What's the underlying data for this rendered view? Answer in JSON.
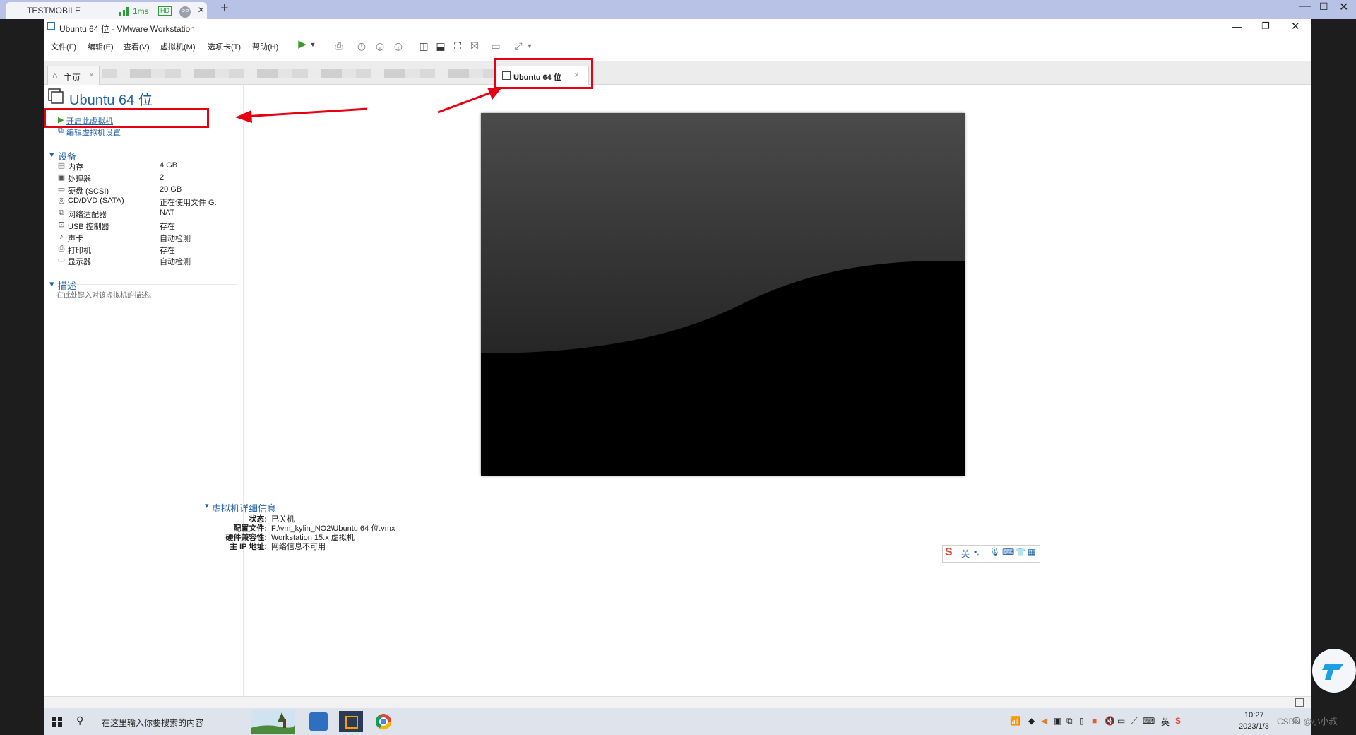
{
  "client": {
    "tab_title": "TESTMOBILE",
    "latency": "1ms",
    "hd": "HD",
    "rp": "RP",
    "close": "×",
    "new_tab": "+",
    "min": "—",
    "max": "☐",
    "window_close": "✕"
  },
  "window": {
    "title": "Ubuntu 64 位 - VMware Workstation",
    "min": "—",
    "restore": "❐",
    "close": "✕"
  },
  "menu": [
    "文件(F)",
    "编辑(E)",
    "查看(V)",
    "虚拟机(M)",
    "选项卡(T)",
    "帮助(H)"
  ],
  "tabs": {
    "home": "主页",
    "home_close": "×",
    "vm": "Ubuntu 64 位",
    "vm_close": "×"
  },
  "vm": {
    "name": "Ubuntu 64 位",
    "power_on": "开启此虚拟机",
    "edit_settings": "编辑虚拟机设置"
  },
  "devices": {
    "heading": "设备",
    "rows": [
      {
        "name": "内存",
        "value": "4 GB",
        "icon": "memory-icon"
      },
      {
        "name": "处理器",
        "value": "2",
        "icon": "cpu-icon"
      },
      {
        "name": "硬盘 (SCSI)",
        "value": "20 GB",
        "icon": "disk-icon"
      },
      {
        "name": "CD/DVD (SATA)",
        "value": "正在使用文件 G:...",
        "icon": "cd-icon"
      },
      {
        "name": "网络适配器",
        "value": "NAT",
        "icon": "network-icon"
      },
      {
        "name": "USB 控制器",
        "value": "存在",
        "icon": "usb-icon"
      },
      {
        "name": "声卡",
        "value": "自动检测",
        "icon": "sound-icon"
      },
      {
        "name": "打印机",
        "value": "存在",
        "icon": "printer-icon"
      },
      {
        "name": "显示器",
        "value": "自动检测",
        "icon": "monitor-icon"
      }
    ]
  },
  "description": {
    "heading": "描述",
    "placeholder": "在此处键入对该虚拟机的描述。"
  },
  "details": {
    "heading": "虚拟机详细信息",
    "rows": [
      {
        "key": "状态:",
        "value": "已关机"
      },
      {
        "key": "配置文件:",
        "value": "F:\\vm_kylin_NO2\\Ubuntu 64 位.vmx"
      },
      {
        "key": "硬件兼容性:",
        "value": "Workstation 15.x 虚拟机"
      },
      {
        "key": "主 IP 地址:",
        "value": "网络信息不可用"
      }
    ]
  },
  "ime": {
    "logo": "S",
    "lang": "英"
  },
  "taskbar": {
    "search_text": "在这里输入你要搜索的内容",
    "tray_lang": "英",
    "time": "10:27",
    "date": "2023/1/3"
  },
  "watermark": "CSDN @小小叔",
  "colors": {
    "accent": "#1e5fa8",
    "highlight": "#e60012",
    "power_green": "#3a9a2a"
  }
}
